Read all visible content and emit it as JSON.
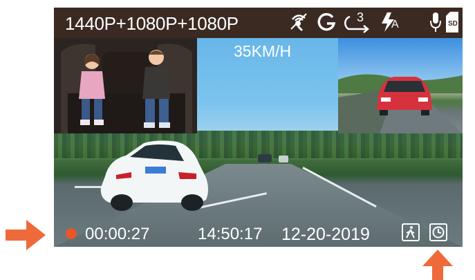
{
  "status_bar": {
    "resolution": "1440P+1080P+1080P",
    "icons": [
      "gps-icon",
      "g-sensor-icon",
      "loop-recording-icon",
      "auto-flash-icon",
      "microphone-icon",
      "sd-card-icon"
    ],
    "loop_minutes": "3",
    "flash_mode": "A",
    "sd_label": "SD"
  },
  "overlay": {
    "speed": "35KM/H"
  },
  "bottom_bar": {
    "elapsed": "00:00:27",
    "time": "14:50:17",
    "date": "12-20-2019",
    "icons": [
      "parking-monitor-icon",
      "timelapse-clock-icon"
    ]
  },
  "colors": {
    "status_bar_bg": "#3a2a22",
    "record_dot": "#e8562a",
    "arrow": "#ee6a3a"
  }
}
